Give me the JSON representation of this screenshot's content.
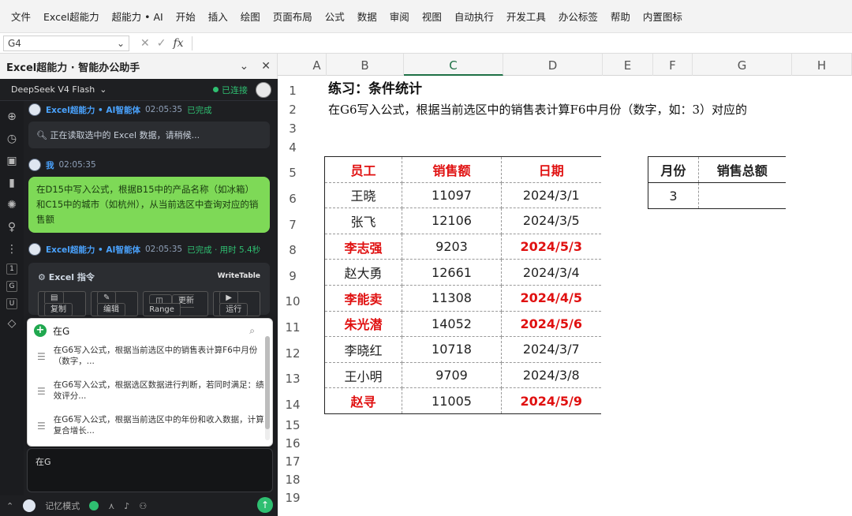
{
  "ribbon": {
    "tabs": [
      "文件",
      "Excel超能力",
      "超能力 • AI",
      "开始",
      "插入",
      "绘图",
      "页面布局",
      "公式",
      "数据",
      "审阅",
      "视图",
      "自动执行",
      "开发工具",
      "办公标签",
      "帮助",
      "内置图标"
    ]
  },
  "formula_bar": {
    "name_box": "G4",
    "fx": "fx",
    "cancel": "✕",
    "confirm": "✓"
  },
  "pane": {
    "title": "Excel超能力 · 智能办公助手",
    "model": "DeepSeek V4 Flash",
    "status": "已连接",
    "messages": {
      "m1_name": "Excel超能力 • AI智能体",
      "m1_time": "02:05:35",
      "m1_status": "已完成",
      "m1_text": "正在读取选中的 Excel 数据，请稍候...",
      "m2_name": "我",
      "m2_time": "02:05:35",
      "m2_text": "在D15中写入公式，根据B15中的产品名称（如冰箱）和C15中的城市（如杭州），从当前选区中查询对应的销售额",
      "m3_name": "Excel超能力 • AI智能体",
      "m3_time": "02:05:35",
      "m3_status": "已完成 · 用时 5.4秒",
      "cmd_title": "Excel 指令",
      "cmd_tag": "WriteTable",
      "cmd_copy": "复制",
      "cmd_edit": "编辑",
      "cmd_range": "更新Range",
      "cmd_run": "运行"
    },
    "suggest": {
      "query": "在G",
      "items": [
        "在G6写入公式，根据当前选区中的销售表计算F6中月份（数字，...",
        "在G6写入公式，根据选区数据进行判断，若同时满足：绩效评分...",
        "在G6写入公式，根据当前选区中的年份和收入数据，计算复合增长..."
      ]
    },
    "input_text": "在G",
    "memory_mode": "记忆模式"
  },
  "sheet": {
    "columns": [
      "A",
      "B",
      "C",
      "D",
      "E",
      "F",
      "G",
      "H"
    ],
    "rows": [
      "1",
      "2",
      "3",
      "4",
      "5",
      "6",
      "7",
      "8",
      "9",
      "10",
      "11",
      "12",
      "13",
      "14",
      "15",
      "16",
      "17",
      "18",
      "19"
    ],
    "title": "练习：条件统计",
    "description": "在G6写入公式，根据当前选区中的销售表计算F6中月份（数字，如：3）对应的",
    "table_headers": [
      "员工",
      "销售额",
      "日期"
    ],
    "table_rows": [
      {
        "name": "王晓",
        "amount": "11097",
        "date": "2024/3/1",
        "red": false
      },
      {
        "name": "张飞",
        "amount": "12106",
        "date": "2024/3/5",
        "red": false
      },
      {
        "name": "李志强",
        "amount": "9203",
        "date": "2024/5/3",
        "red": true
      },
      {
        "name": "赵大勇",
        "amount": "12661",
        "date": "2024/3/4",
        "red": false
      },
      {
        "name": "李能卖",
        "amount": "11308",
        "date": "2024/4/5",
        "red": true
      },
      {
        "name": "朱光潜",
        "amount": "14052",
        "date": "2024/5/6",
        "red": true
      },
      {
        "name": "李晓红",
        "amount": "10718",
        "date": "2024/3/7",
        "red": false
      },
      {
        "name": "王小明",
        "amount": "9709",
        "date": "2024/3/8",
        "red": false
      },
      {
        "name": "赵寻",
        "amount": "11005",
        "date": "2024/5/9",
        "red": true
      }
    ],
    "summary_headers": [
      "月份",
      "销售总额"
    ],
    "summary_values": [
      "3",
      ""
    ]
  }
}
